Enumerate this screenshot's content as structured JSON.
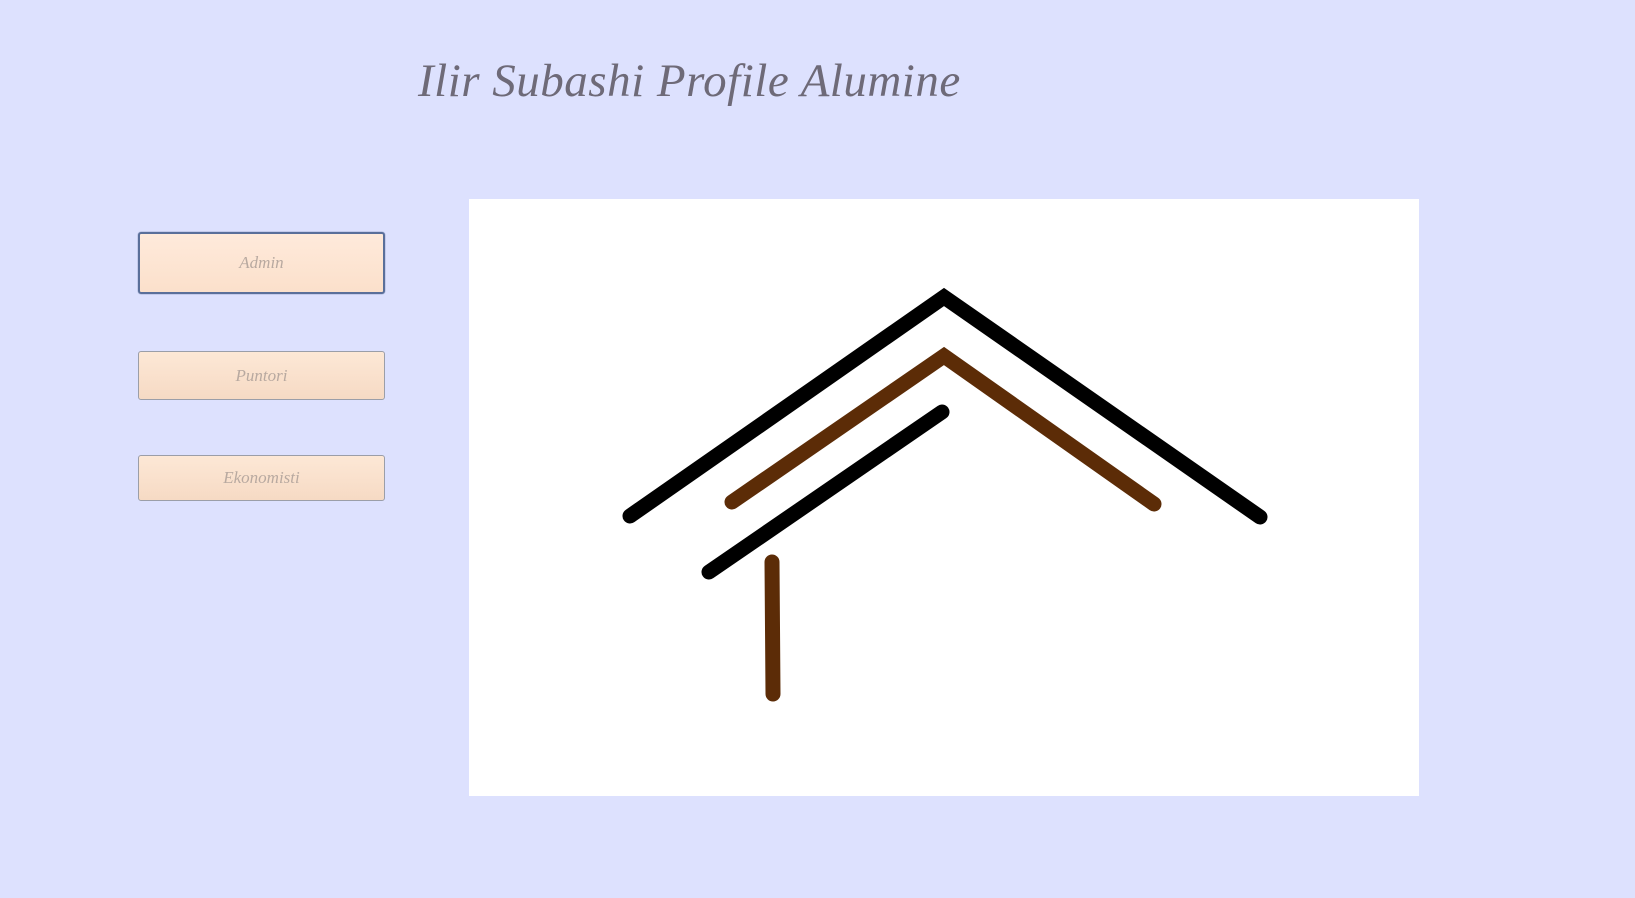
{
  "window": {
    "title": "Ilir Subashi Profile Alumine",
    "background_color": "#dde1fe"
  },
  "sidebar": {
    "buttons": [
      {
        "label": "Admin",
        "focused": true
      },
      {
        "label": "Puntori",
        "focused": false
      },
      {
        "label": "Ekonomisti",
        "focused": false
      }
    ]
  },
  "logo": {
    "icon": "house-roof-logo-icon",
    "colors": {
      "primary": "#000000",
      "accent": "#5c2c07"
    }
  }
}
